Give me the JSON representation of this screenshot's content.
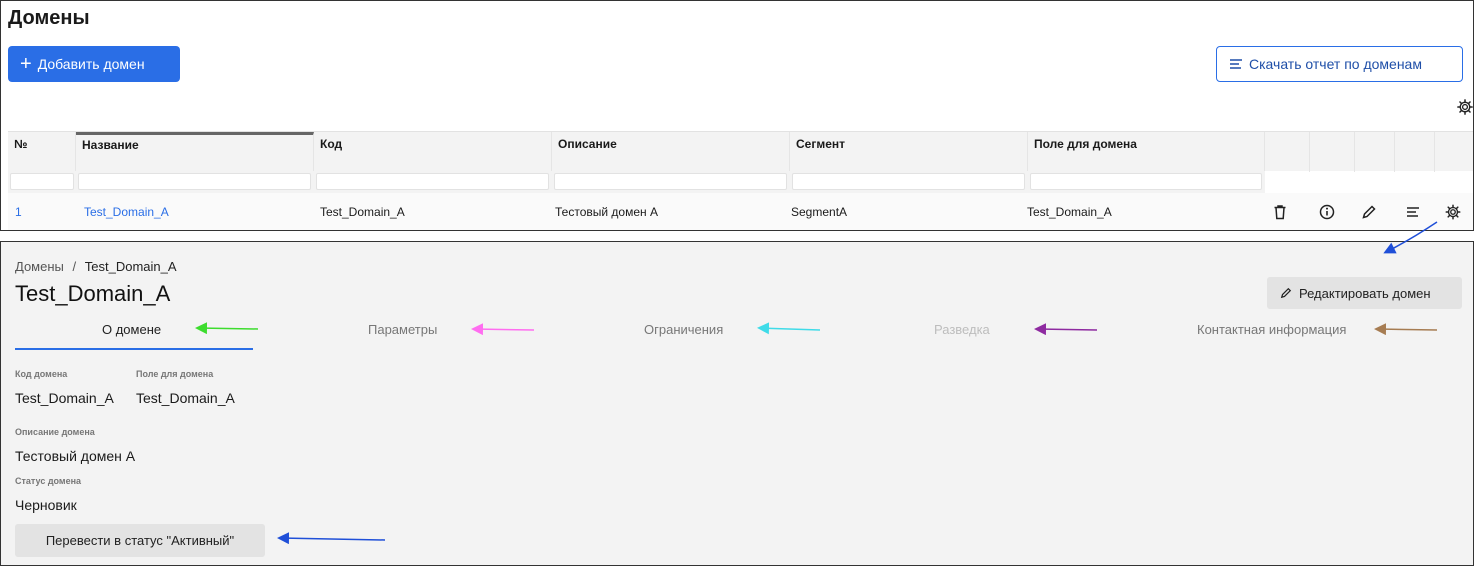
{
  "domain_list": {
    "title": "Домены",
    "add_button_label": "Добавить домен",
    "report_button_label": "Скачать отчет по доменам",
    "table": {
      "headers": [
        "№",
        "Название",
        "Код",
        "Описание",
        "Сегмент",
        "Поле для домена"
      ],
      "rows": [
        {
          "num": "1",
          "name": "Test_Domain_A",
          "code": "Test_Domain_A",
          "description": "Тестовый домен А",
          "segment": "SegmentA",
          "domain_field": "Test_Domain_A"
        }
      ]
    }
  },
  "domain_detail": {
    "breadcrumb": {
      "root": "Домены",
      "separator": "/",
      "current": "Test_Domain_A"
    },
    "title": "Test_Domain_A",
    "edit_button_label": "Редактировать домен",
    "tabs": [
      {
        "label": "О домене",
        "state": "active"
      },
      {
        "label": "Параметры",
        "state": "normal"
      },
      {
        "label": "Ограничения",
        "state": "normal"
      },
      {
        "label": "Разведка",
        "state": "disabled"
      },
      {
        "label": "Контактная информация",
        "state": "normal"
      }
    ],
    "fields": {
      "code_label": "Код домена",
      "code_value": "Test_Domain_A",
      "domain_field_label": "Поле для домена",
      "domain_field_value": "Test_Domain_A",
      "description_label": "Описание домена",
      "description_value": "Тестовый домен А",
      "status_label": "Статус домена",
      "status_value": "Черновик"
    },
    "status_button_label": "Перевести в статус \"Активный\""
  },
  "colors": {
    "primary": "#2a6ee6",
    "annotation_blue": "#1f4fd8",
    "annotation_green": "#3ddc2e",
    "annotation_pink": "#ff6df0",
    "annotation_cyan": "#3fdbe8",
    "annotation_purple": "#8e2aa0",
    "annotation_brown": "#a67c52"
  }
}
